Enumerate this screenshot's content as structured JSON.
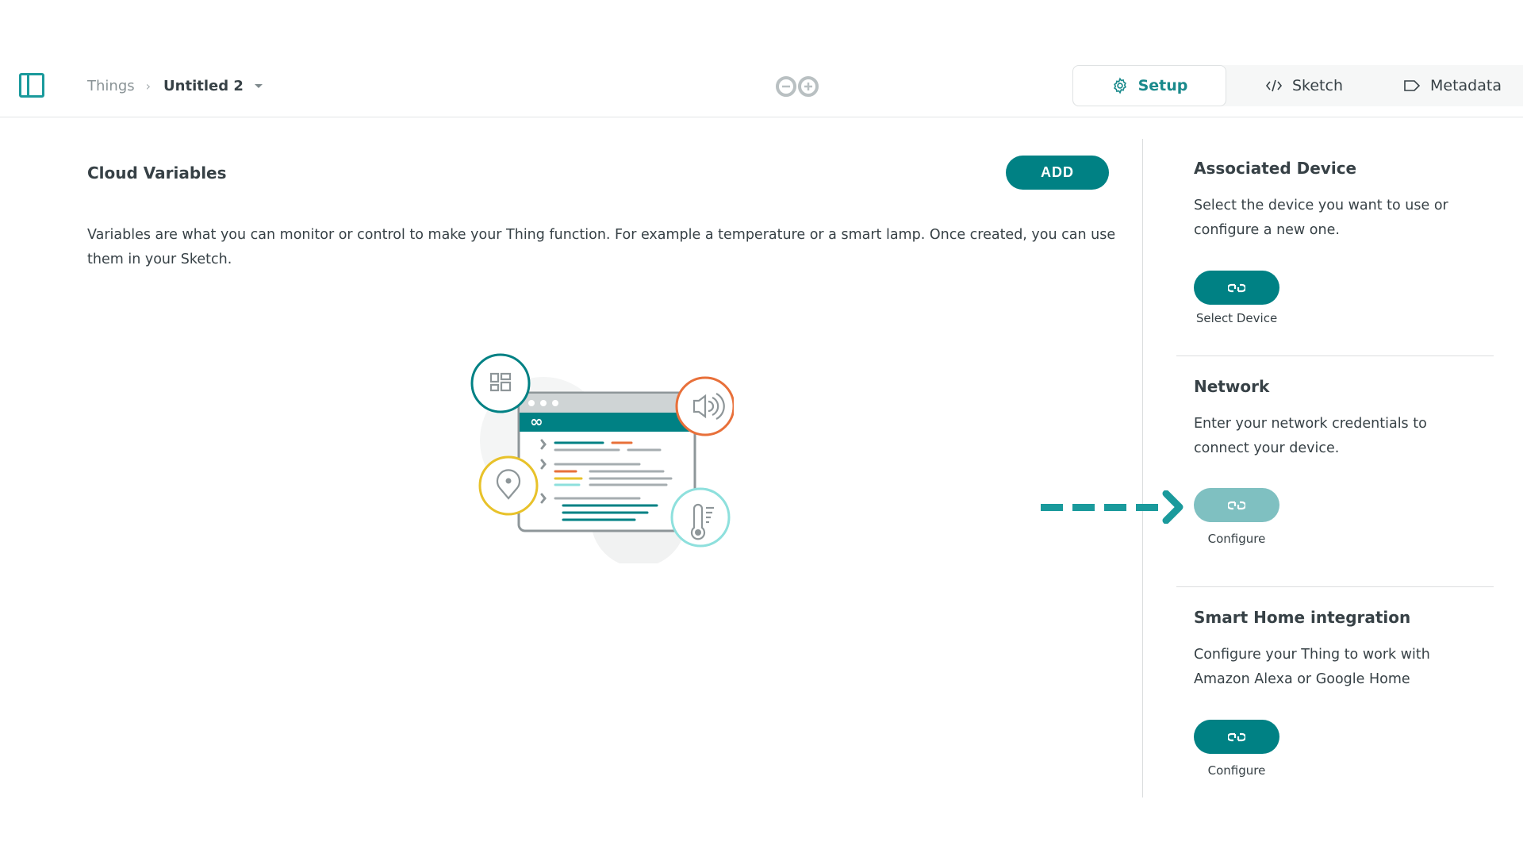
{
  "header": {
    "breadcrumb": {
      "parent": "Things",
      "separator": "›",
      "current": "Untitled 2"
    },
    "logo": "arduino-infinity-logo",
    "tabs": [
      {
        "label": "Setup",
        "icon": "gear-icon",
        "active": true
      },
      {
        "label": "Sketch",
        "icon": "code-icon",
        "active": false
      },
      {
        "label": "Metadata",
        "icon": "tag-icon",
        "active": false
      }
    ]
  },
  "main": {
    "title": "Cloud Variables",
    "add_label": "ADD",
    "description": "Variables are what you can monitor or control to make your Thing function. For example a temperature or a smart lamp. Once created, you can use them in your Sketch.",
    "illustration": "cloud-variables-illustration"
  },
  "right_panel": {
    "sections": [
      {
        "title": "Associated Device",
        "description": "Select the device you want to use or configure a new one.",
        "button_label": "Select Device",
        "button_icon": "link-icon",
        "enabled": true
      },
      {
        "title": "Network",
        "description": "Enter your network credentials to connect your device.",
        "button_label": "Configure",
        "button_icon": "link-icon",
        "enabled": false
      },
      {
        "title": "Smart Home integration",
        "description": "Configure your Thing to work with Amazon Alexa or Google Home",
        "button_label": "Configure",
        "button_icon": "link-icon",
        "enabled": true
      }
    ]
  },
  "colors": {
    "accent": "#008184",
    "accent_disabled": "#7fc0c1",
    "text": "#374146",
    "muted": "#8a9396",
    "orange": "#e8703a",
    "yellow": "#e8c22a",
    "light_teal": "#8ee0dd"
  }
}
